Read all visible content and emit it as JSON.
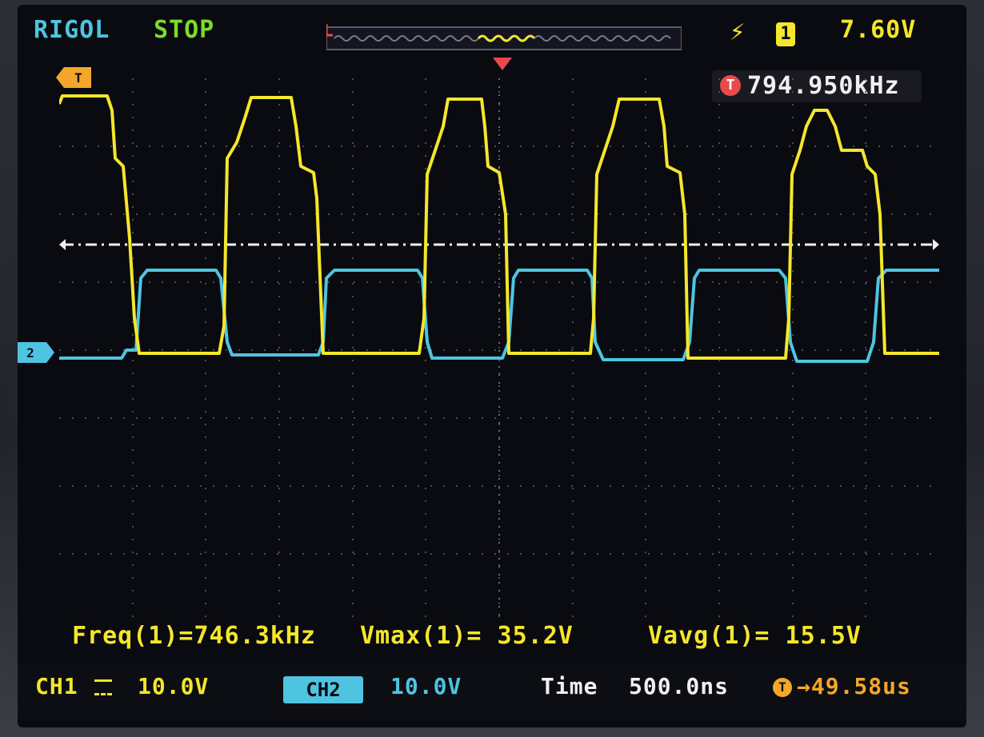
{
  "header": {
    "brand": "RIGOL",
    "run_state": "STOP",
    "trigger_slope_icon": "rising-edge-icon",
    "trigger_source": "1",
    "trigger_level": "7.60V",
    "trigger_frequency": "794.950kHz",
    "trigger_freq_badge": "T"
  },
  "markers": {
    "ch1_trigger_marker": "T",
    "ch2_ground_marker": "2"
  },
  "measurements": {
    "freq": "Freq(1)=746.3kHz",
    "vmax": "Vmax(1)= 35.2V",
    "vavg": "Vavg(1)= 15.5V"
  },
  "status_bar": {
    "ch1_label": "CH1",
    "ch1_scale": "10.0V",
    "ch2_label": "CH2",
    "ch2_scale": "10.0V",
    "time_label": "Time",
    "time_scale": "500.0ns",
    "trigger_offset_badge": "T",
    "trigger_offset": "→49.58us"
  },
  "colors": {
    "ch1": "#f4e62a",
    "ch2": "#4fc4e0",
    "trigger_line": "#f0f0f0",
    "grid": "#4a4c56",
    "background": "#0a0b10"
  }
}
